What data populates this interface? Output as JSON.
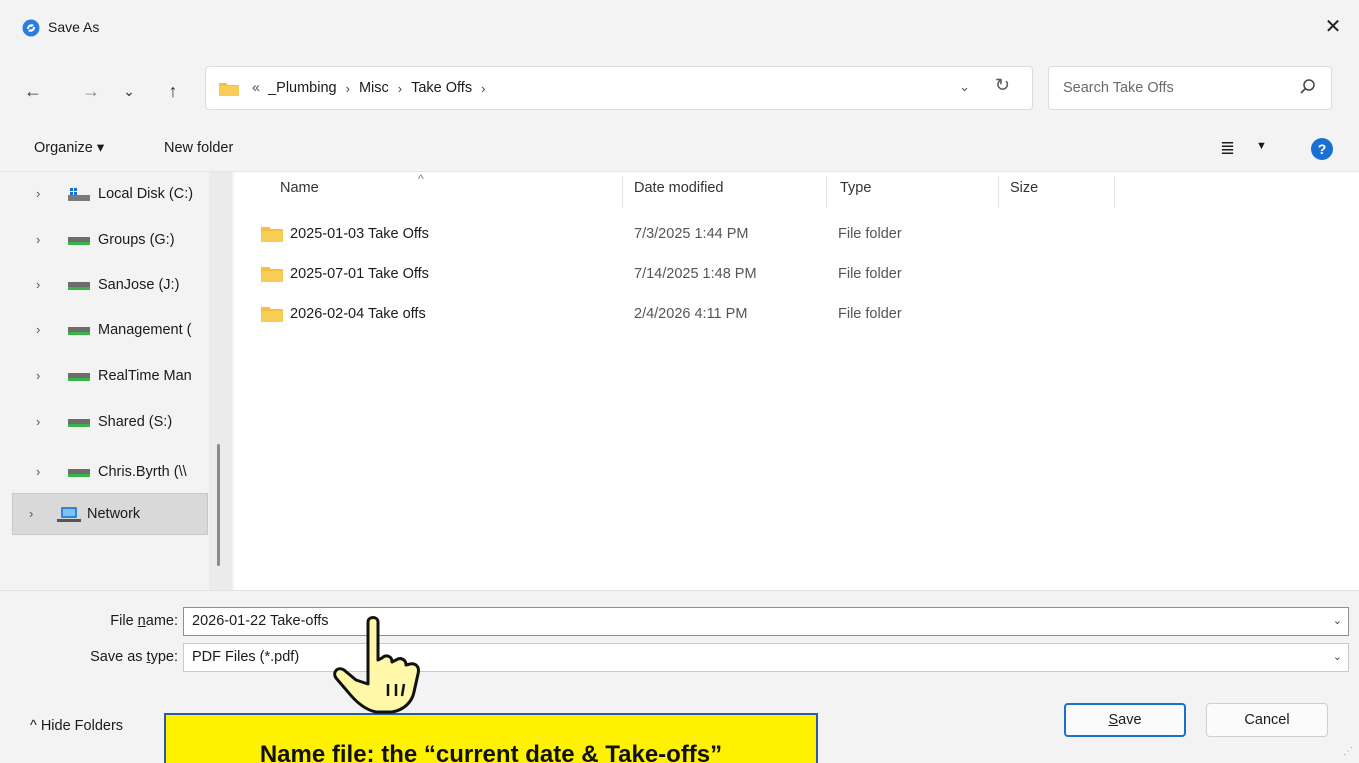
{
  "window": {
    "title": "Save As",
    "close_glyph": "✕"
  },
  "nav": {
    "back": "←",
    "forward": "→",
    "recent": "⌄",
    "up": "↑",
    "breadcrumbs": [
      "«",
      "_Plumbing",
      "Misc",
      "Take Offs"
    ],
    "crumb_sep": "›",
    "dropdown": "⌄",
    "refresh": "↻",
    "search_placeholder": "Search Take Offs"
  },
  "toolbar": {
    "organize": "Organize ▾",
    "new_folder": "New folder",
    "view_glyph": "≣",
    "view_dd": "▼",
    "help": "?"
  },
  "sidebar": {
    "items": [
      {
        "label": "Local Disk (C:)",
        "icon": "windows-drive-icon"
      },
      {
        "label": "Groups (G:)",
        "icon": "network-drive-icon"
      },
      {
        "label": "SanJose (J:)",
        "icon": "network-drive-icon"
      },
      {
        "label": "Management (",
        "icon": "network-drive-icon"
      },
      {
        "label": "RealTime Man",
        "icon": "network-drive-icon"
      },
      {
        "label": "Shared (S:)",
        "icon": "network-drive-icon"
      },
      {
        "label": "Chris.Byrth (\\\\",
        "icon": "network-drive-icon"
      },
      {
        "label": "Network",
        "icon": "network-icon"
      }
    ],
    "chevron": "›"
  },
  "columns": {
    "name": "Name",
    "date": "Date modified",
    "type": "Type",
    "size": "Size",
    "sort_caret": "^"
  },
  "files": [
    {
      "name": "2025-01-03 Take Offs",
      "date": "7/3/2025 1:44 PM",
      "type": "File folder"
    },
    {
      "name": "2025-07-01 Take Offs",
      "date": "7/14/2025 1:48 PM",
      "type": "File folder"
    },
    {
      "name": "2026-02-04 Take offs",
      "date": "2/4/2026 4:11 PM",
      "type": "File folder"
    }
  ],
  "form": {
    "file_name_label_pre": "File ",
    "file_name_label_u": "n",
    "file_name_label_post": "ame:",
    "file_name_value": "2026-01-22 Take-offs",
    "save_type_label_pre": "Save as ",
    "save_type_label_u": "t",
    "save_type_label_post": "ype:",
    "save_type_value": "PDF Files (*.pdf)",
    "dd": "⌄"
  },
  "footer": {
    "hide_folders": "^  Hide Folders",
    "save_u": "S",
    "save_rest": "ave",
    "cancel": "Cancel"
  },
  "callout": {
    "text": "Name file: the “current date & Take-offs”"
  },
  "colors": {
    "accent": "#1a6fd3",
    "folder": "#f4c041",
    "callout_bg": "#fff200",
    "callout_border": "#2d5ba8"
  }
}
